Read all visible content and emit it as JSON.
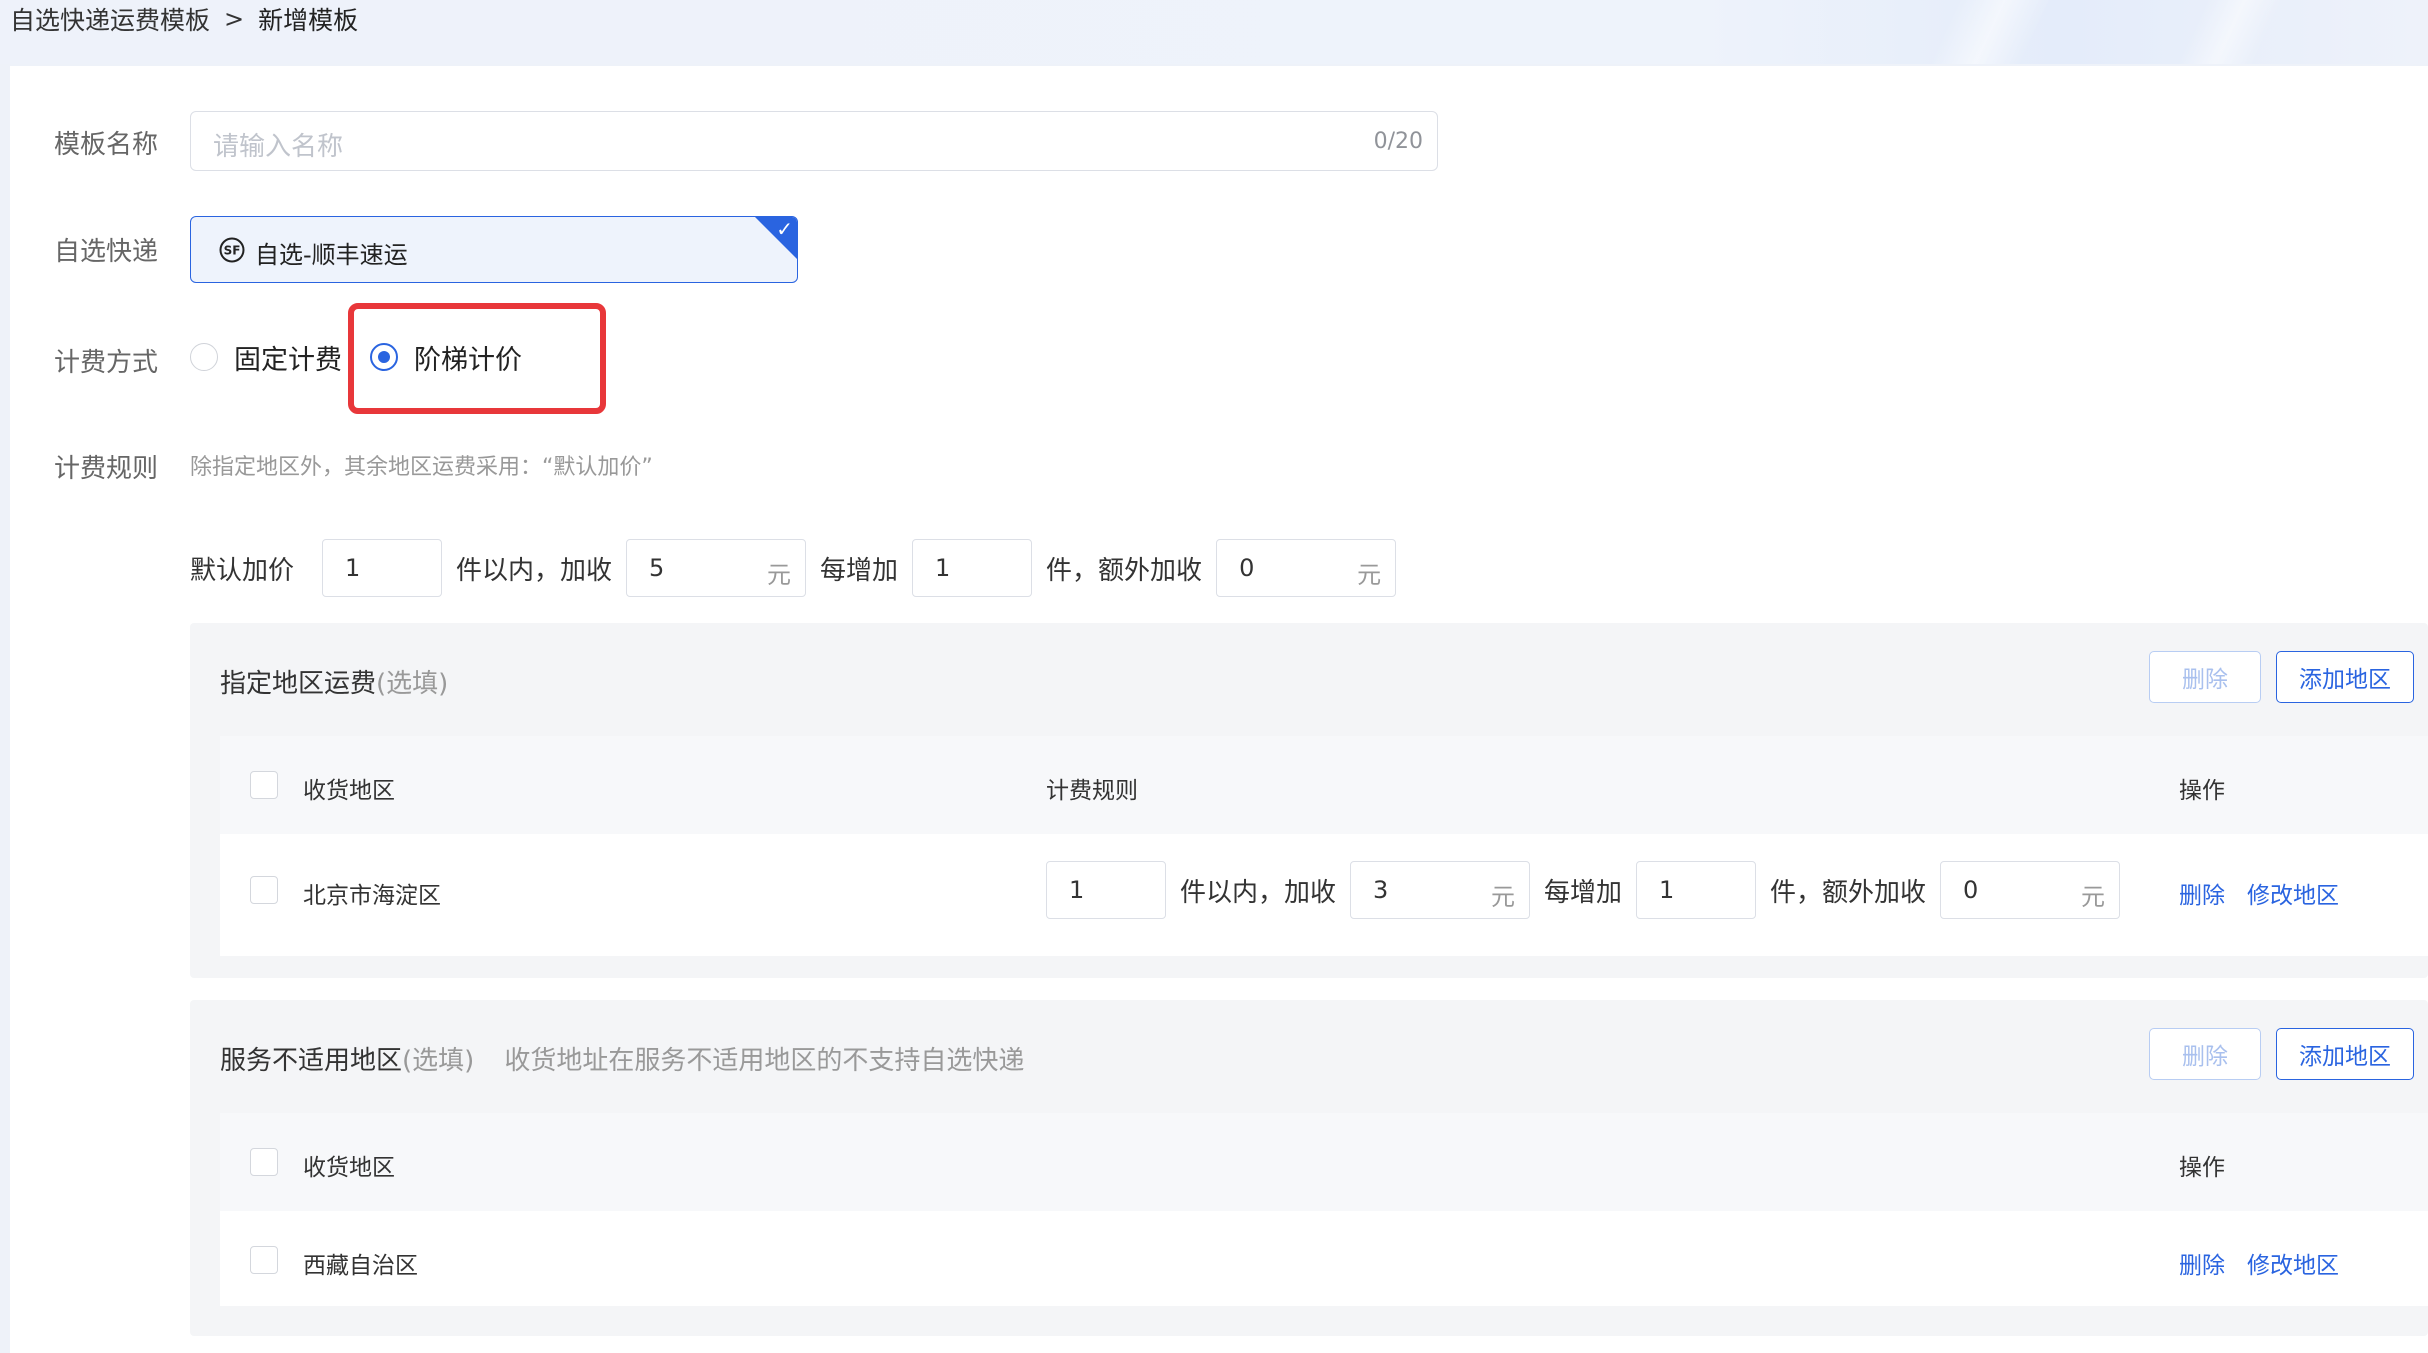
{
  "breadcrumb": {
    "parent": "自选快递运费模板",
    "separator": ">",
    "current": "新增模板"
  },
  "form": {
    "name_label": "模板名称",
    "name_placeholder": "请输入名称",
    "name_counter": "0/20",
    "express_label": "自选快递",
    "express_name": "自选-顺丰速运",
    "express_icon": "sf-logo-icon",
    "billing_label": "计费方式",
    "billing_options": [
      "固定计费",
      "阶梯计价"
    ],
    "billing_selected": "阶梯计价",
    "rule_label": "计费规则",
    "rule_hint": "除指定地区外，其余地区运费采用：“默认加价”"
  },
  "default_pricing": {
    "label": "默认加价",
    "first_qty": "1",
    "text_within": "件以内，加收",
    "first_fee": "5",
    "unit": "元",
    "text_each": "每增加",
    "step_qty": "1",
    "text_extra": "件，额外加收",
    "step_fee": "0"
  },
  "designated": {
    "title": "指定地区运费",
    "optional": "(选填)",
    "delete_button": "删除",
    "add_button": "添加地区",
    "columns": {
      "region": "收货地区",
      "rule": "计费规则",
      "action": "操作"
    },
    "rows": [
      {
        "region": "北京市海淀区",
        "first_qty": "1",
        "first_fee": "3",
        "step_qty": "1",
        "step_fee": "0",
        "text_within": "件以内，加收",
        "text_each": "每增加",
        "text_extra": "件，额外加收",
        "unit": "元",
        "delete": "删除",
        "modify": "修改地区"
      }
    ]
  },
  "unsupported": {
    "title": "服务不适用地区",
    "optional": "(选填)",
    "description": "收货地址在服务不适用地区的不支持自选快递",
    "delete_button": "删除",
    "add_button": "添加地区",
    "columns": {
      "region": "收货地区",
      "action": "操作"
    },
    "rows": [
      {
        "region": "西藏自治区",
        "delete": "删除",
        "modify": "修改地区"
      }
    ]
  },
  "colors": {
    "accent": "#2a64e0",
    "highlight": "#e8373a",
    "muted": "#999999"
  }
}
